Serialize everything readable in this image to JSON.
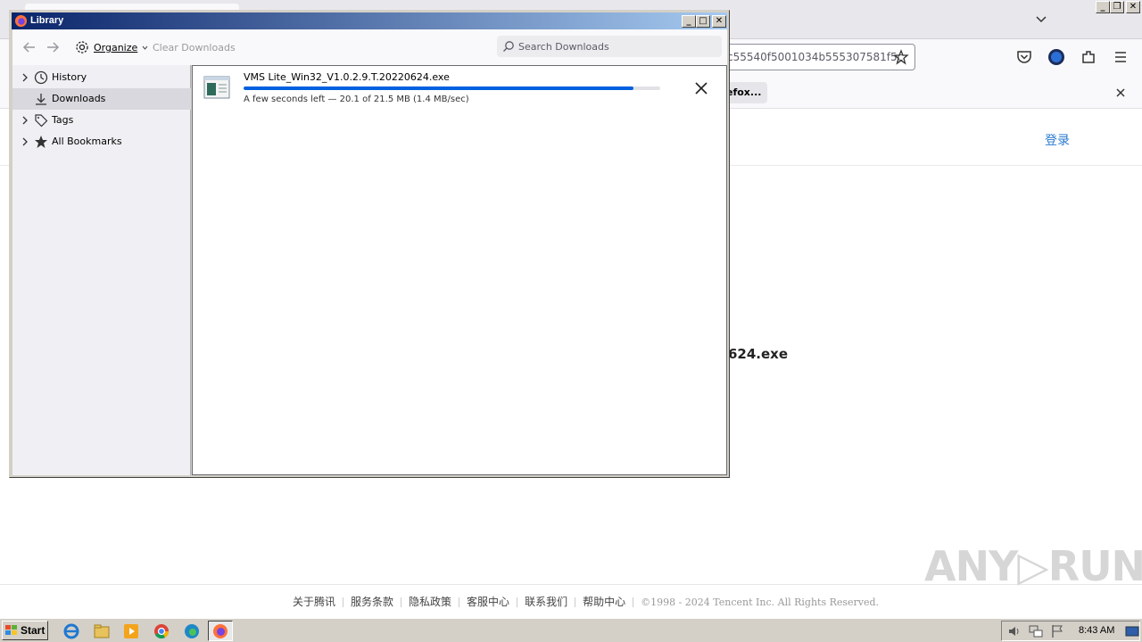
{
  "background_browser": {
    "url_text": "c55540f5001034b555307581f5c",
    "notification_button": "efox...",
    "login_link": "登录",
    "page_filename": "624.exe",
    "footer_links": [
      "关于腾讯",
      "服务条款",
      "隐私政策",
      "客服中心",
      "联系我们",
      "帮助中心"
    ],
    "copyright": "©1998 - 2024 Tencent Inc. All Rights Reserved.",
    "watermark": "ANY▷RUN"
  },
  "library": {
    "title": "Library",
    "toolbar": {
      "organize_label": "Organize",
      "clear_label": "Clear Downloads",
      "search_placeholder": "Search Downloads"
    },
    "sidebar": {
      "items": [
        {
          "label": "History",
          "icon": "clock-icon",
          "expandable": true,
          "selected": false
        },
        {
          "label": "Downloads",
          "icon": "download-icon",
          "expandable": false,
          "selected": true
        },
        {
          "label": "Tags",
          "icon": "tag-icon",
          "expandable": true,
          "selected": false
        },
        {
          "label": "All Bookmarks",
          "icon": "star-icon",
          "expandable": true,
          "selected": false
        }
      ]
    },
    "download": {
      "filename": "VMS Lite_Win32_V1.0.2.9.T.20220624.exe",
      "status": "A few seconds left — 20.1 of 21.5 MB (1.4 MB/sec)",
      "progress_percent": 93.5
    }
  },
  "taskbar": {
    "start_label": "Start",
    "time": "8:43 AM"
  },
  "colors": {
    "progress": "#0060df",
    "titlebar_start": "#0a246a",
    "titlebar_end": "#a6caf0",
    "login_link": "#2a7ad0"
  }
}
